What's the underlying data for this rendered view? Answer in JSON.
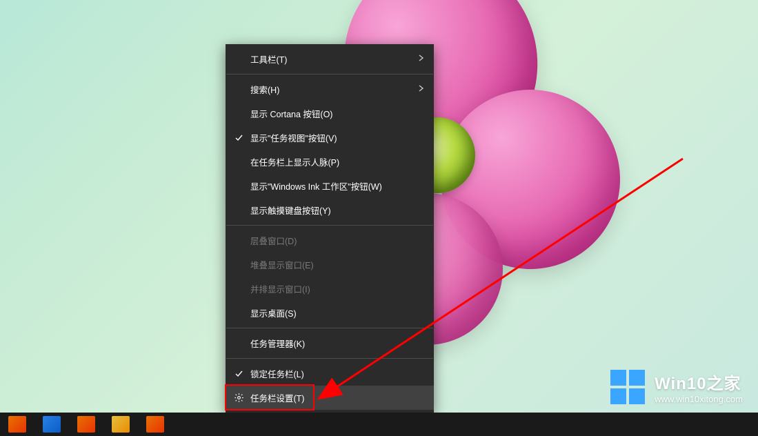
{
  "menu": {
    "items": [
      {
        "label": "工具栏(T)",
        "has_submenu": true
      },
      {
        "label": "搜索(H)",
        "has_submenu": true
      },
      {
        "label": "显示 Cortana 按钮(O)"
      },
      {
        "label": "显示\"任务视图\"按钮(V)",
        "checked": true
      },
      {
        "label": "在任务栏上显示人脉(P)"
      },
      {
        "label": "显示\"Windows Ink 工作区\"按钮(W)"
      },
      {
        "label": "显示触摸键盘按钮(Y)"
      },
      {
        "label": "层叠窗口(D)",
        "disabled": true
      },
      {
        "label": "堆叠显示窗口(E)",
        "disabled": true
      },
      {
        "label": "并排显示窗口(I)",
        "disabled": true
      },
      {
        "label": "显示桌面(S)"
      },
      {
        "label": "任务管理器(K)"
      },
      {
        "label": "锁定任务栏(L)",
        "checked": true
      },
      {
        "label": "任务栏设置(T)",
        "icon": "gear",
        "hovered": true,
        "highlighted": true
      }
    ]
  },
  "watermark": {
    "title": "Win10之家",
    "url": "www.win10xitong.com"
  }
}
